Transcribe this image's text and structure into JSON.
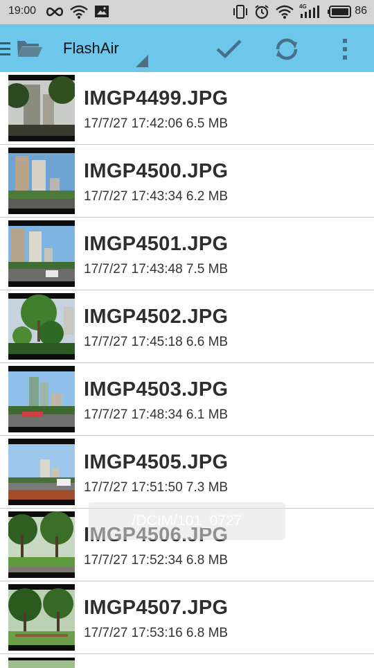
{
  "status_bar": {
    "time": "19:00",
    "network_type": "4G",
    "battery": "86"
  },
  "app_bar": {
    "title": "FlashAir",
    "icons": [
      "menu-icon",
      "folder-icon",
      "check-icon",
      "sync-icon",
      "more-vert-icon"
    ],
    "accent_color": "#6cc7eb"
  },
  "files": [
    {
      "name": "IMGP4499.JPG",
      "meta": "17/7/27 17:42:06 6.5 MB"
    },
    {
      "name": "IMGP4500.JPG",
      "meta": "17/7/27 17:43:34 6.2 MB"
    },
    {
      "name": "IMGP4501.JPG",
      "meta": "17/7/27 17:43:48 7.5 MB"
    },
    {
      "name": "IMGP4502.JPG",
      "meta": "17/7/27 17:45:18 6.6 MB"
    },
    {
      "name": "IMGP4503.JPG",
      "meta": "17/7/27 17:48:34 6.1 MB"
    },
    {
      "name": "IMGP4505.JPG",
      "meta": "17/7/27 17:51:50 7.3 MB"
    },
    {
      "name": "IMGP4506.JPG",
      "meta": "17/7/27 17:52:34 6.8 MB"
    },
    {
      "name": "IMGP4507.JPG",
      "meta": "17/7/27 17:53:16 6.8 MB"
    }
  ],
  "toast": "/DCIM/101_0727"
}
